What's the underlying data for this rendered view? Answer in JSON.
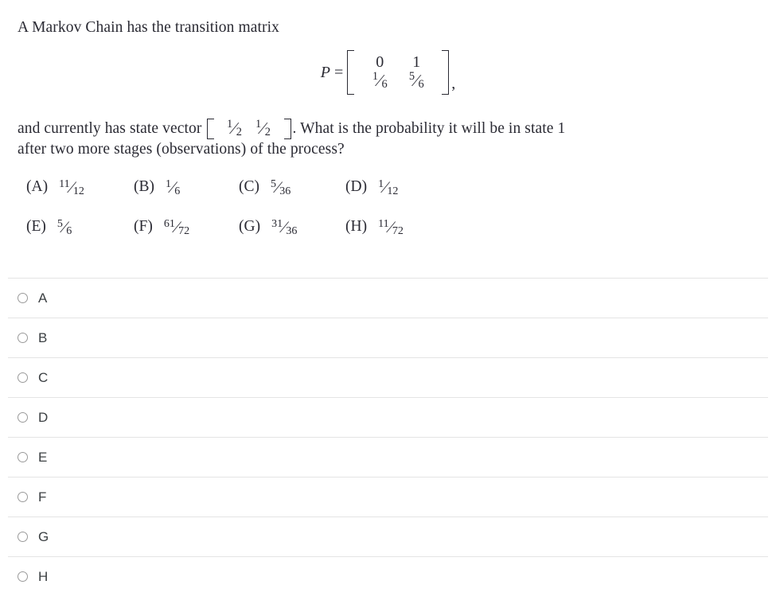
{
  "question": {
    "stem": "A Markov Chain has the transition matrix",
    "matrix": {
      "variable": "P",
      "equals": "=",
      "rows": [
        [
          {
            "type": "int",
            "text": "0"
          },
          {
            "type": "int",
            "text": "1"
          }
        ],
        [
          {
            "type": "frac",
            "num": "1",
            "den": "6"
          },
          {
            "type": "frac",
            "num": "5",
            "den": "6"
          }
        ]
      ],
      "trailing_punctuation": ","
    },
    "body_before_vector": "and currently has state vector",
    "state_vector": [
      {
        "type": "frac",
        "num": "1",
        "den": "2"
      },
      {
        "type": "frac",
        "num": "1",
        "den": "2"
      }
    ],
    "body_after_vector": ". What is the probability it will be in state 1",
    "body_line_2": "after two more stages (observations) of the process?"
  },
  "choices": [
    {
      "tag": "(A)",
      "num": "11",
      "den": "12"
    },
    {
      "tag": "(B)",
      "num": "1",
      "den": "6"
    },
    {
      "tag": "(C)",
      "num": "5",
      "den": "36"
    },
    {
      "tag": "(D)",
      "num": "1",
      "den": "12"
    },
    {
      "tag": "(E)",
      "num": "5",
      "den": "6"
    },
    {
      "tag": "(F)",
      "num": "61",
      "den": "72"
    },
    {
      "tag": "(G)",
      "num": "31",
      "den": "36"
    },
    {
      "tag": "(H)",
      "num": "11",
      "den": "72"
    }
  ],
  "options": [
    {
      "label": "A",
      "selected": false
    },
    {
      "label": "B",
      "selected": false
    },
    {
      "label": "C",
      "selected": false
    },
    {
      "label": "D",
      "selected": false
    },
    {
      "label": "E",
      "selected": false
    },
    {
      "label": "F",
      "selected": false
    },
    {
      "label": "G",
      "selected": false
    },
    {
      "label": "H",
      "selected": false
    }
  ],
  "colors": {
    "background": "#ffffff",
    "text": "#2a2a33",
    "option_text": "#3c4043",
    "divider": "#e4e4e4",
    "radio_border": "#9a9a9a"
  }
}
